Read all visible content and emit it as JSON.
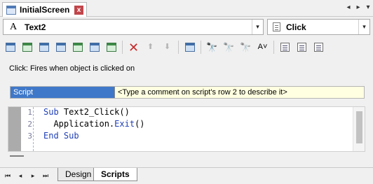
{
  "document_tab": {
    "title": "InitialScreen",
    "close_glyph": "x"
  },
  "tab_nav": {
    "prev": "◂",
    "next": "▸",
    "menu": "▾"
  },
  "object_selector": {
    "glyph": "A",
    "value": "Text2",
    "dropdown": "▾"
  },
  "event_selector": {
    "value": "Click",
    "dropdown": "▾"
  },
  "toolbar": {
    "icons": [
      "new-script-icon",
      "add-event-icon",
      "insert-icon",
      "screen-icon",
      "refresh-icon",
      "sync-icon",
      "run-icon",
      "delete-icon",
      "move-up-icon",
      "move-down-icon",
      "goto-icon",
      "find-icon",
      "find-next-icon",
      "replace-icon",
      "spellcheck-icon",
      "format-icon",
      "comment-icon",
      "uncomment-icon"
    ],
    "delete_glyph": "✕",
    "up_glyph": "⬆",
    "down_glyph": "⬇",
    "find_glyph": "🔭",
    "spell_glyph": "A˅"
  },
  "description": "Click: Fires when object is clicked on",
  "script_row": {
    "name_value": "Script",
    "hint": "<Type a comment on script's row 2 to describe it>"
  },
  "editor": {
    "line_numbers": [
      "1",
      "2",
      "3"
    ],
    "lines": [
      {
        "kw1": "Sub",
        "rest1": " Text2_Click()"
      },
      {
        "plain": "  Application.",
        "kw": "Exit",
        "tail": "()"
      },
      {
        "kw1": "End",
        "kw2": " Sub"
      }
    ]
  },
  "sheet_nav": {
    "first": "⏮",
    "prev": "◂",
    "next": "▸",
    "last": "⏭"
  },
  "sheet_tabs": [
    {
      "label": "Design"
    },
    {
      "label": "Scripts"
    }
  ],
  "colors": {
    "selection": "#3f78c9",
    "keyword": "#1f3fb8",
    "hint_background": "#ffffe1",
    "close_button": "#c0454a"
  }
}
